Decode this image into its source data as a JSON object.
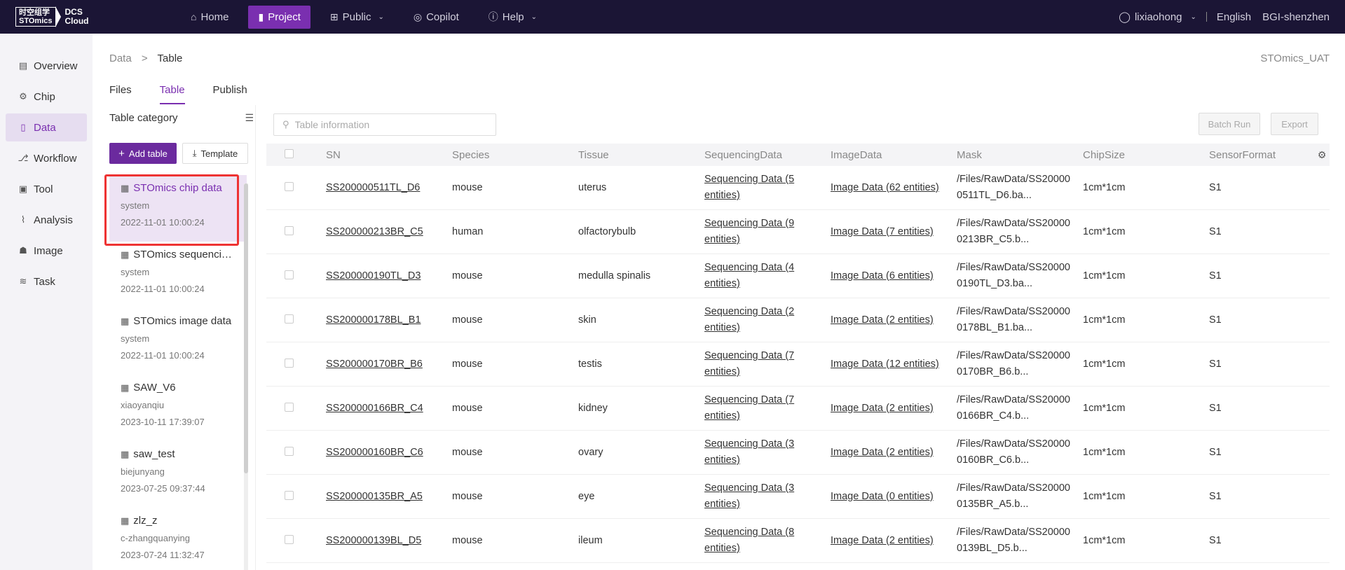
{
  "logo": {
    "cn": "时空组学",
    "en": "STOmics",
    "product_line1": "DCS",
    "product_line2": "Cloud"
  },
  "nav": {
    "items": [
      {
        "label": "Home",
        "icon": "home-icon"
      },
      {
        "label": "Project",
        "icon": "file-icon",
        "active": true
      },
      {
        "label": "Public",
        "icon": "grid-icon",
        "dropdown": true
      },
      {
        "label": "Copilot",
        "icon": "copilot-icon"
      },
      {
        "label": "Help",
        "icon": "help-icon",
        "dropdown": true
      }
    ],
    "user": "lixiaohong",
    "language": "English",
    "region": "BGI-shenzhen"
  },
  "sidebar": {
    "items": [
      {
        "label": "Overview",
        "icon": "document-icon"
      },
      {
        "label": "Chip",
        "icon": "chip-icon"
      },
      {
        "label": "Data",
        "icon": "data-file-icon",
        "active": true
      },
      {
        "label": "Workflow",
        "icon": "workflow-icon"
      },
      {
        "label": "Tool",
        "icon": "tool-icon"
      },
      {
        "label": "Analysis",
        "icon": "analysis-icon"
      },
      {
        "label": "Image",
        "icon": "image-icon"
      },
      {
        "label": "Task",
        "icon": "layers-icon"
      }
    ]
  },
  "breadcrumb": {
    "parent": "Data",
    "separator": ">",
    "current": "Table"
  },
  "tenant": "STOmics_UAT",
  "tabs": [
    {
      "label": "Files"
    },
    {
      "label": "Table",
      "active": true
    },
    {
      "label": "Publish"
    }
  ],
  "category_panel": {
    "title": "Table category",
    "add_button": "Add table",
    "template_button": "Template",
    "items": [
      {
        "name": "STOmics chip data",
        "owner": "system",
        "date": "2022-11-01 10:00:24",
        "active": true
      },
      {
        "name": "STOmics sequencing data",
        "owner": "system",
        "date": "2022-11-01 10:00:24"
      },
      {
        "name": "STOmics image data",
        "owner": "system",
        "date": "2022-11-01 10:00:24"
      },
      {
        "name": "SAW_V6",
        "owner": "xiaoyanqiu",
        "date": "2023-10-11 17:39:07"
      },
      {
        "name": "saw_test",
        "owner": "biejunyang",
        "date": "2023-07-25 09:37:44"
      },
      {
        "name": "zlz_z",
        "owner": "c-zhangquanying",
        "date": "2023-07-24 11:32:47"
      }
    ]
  },
  "toolbar": {
    "search_placeholder": "Table information",
    "batch_run": "Batch Run",
    "export": "Export"
  },
  "table": {
    "columns": [
      "SN",
      "Species",
      "Tissue",
      "SequencingData",
      "ImageData",
      "Mask",
      "ChipSize",
      "SensorFormat"
    ],
    "rows": [
      {
        "sn": "SS200000511TL_D6",
        "species": "mouse",
        "tissue": "uterus",
        "seq": "Sequencing Data (5 entities)",
        "img": "Image Data (62 entities)",
        "mask": "/Files/RawData/SS200000511TL_D6.ba...",
        "chip": "1cm*1cm",
        "sensor": "S1"
      },
      {
        "sn": "SS200000213BR_C5",
        "species": "human",
        "tissue": "olfactorybulb",
        "seq": "Sequencing Data (9 entities)",
        "img": "Image Data (7 entities)",
        "mask": "/Files/RawData/SS200000213BR_C5.b...",
        "chip": "1cm*1cm",
        "sensor": "S1"
      },
      {
        "sn": "SS200000190TL_D3",
        "species": "mouse",
        "tissue": "medulla spinalis",
        "seq": "Sequencing Data (4 entities)",
        "img": "Image Data (6 entities)",
        "mask": "/Files/RawData/SS200000190TL_D3.ba...",
        "chip": "1cm*1cm",
        "sensor": "S1"
      },
      {
        "sn": "SS200000178BL_B1",
        "species": "mouse",
        "tissue": "skin",
        "seq": "Sequencing Data (2 entities)",
        "img": "Image Data (2 entities)",
        "mask": "/Files/RawData/SS200000178BL_B1.ba...",
        "chip": "1cm*1cm",
        "sensor": "S1"
      },
      {
        "sn": "SS200000170BR_B6",
        "species": "mouse",
        "tissue": "testis",
        "seq": "Sequencing Data (7 entities)",
        "img": "Image Data (12 entities)",
        "mask": "/Files/RawData/SS200000170BR_B6.b...",
        "chip": "1cm*1cm",
        "sensor": "S1"
      },
      {
        "sn": "SS200000166BR_C4",
        "species": "mouse",
        "tissue": "kidney",
        "seq": "Sequencing Data (7 entities)",
        "img": "Image Data (2 entities)",
        "mask": "/Files/RawData/SS200000166BR_C4.b...",
        "chip": "1cm*1cm",
        "sensor": "S1"
      },
      {
        "sn": "SS200000160BR_C6",
        "species": "mouse",
        "tissue": "ovary",
        "seq": "Sequencing Data (3 entities)",
        "img": "Image Data (2 entities)",
        "mask": "/Files/RawData/SS200000160BR_C6.b...",
        "chip": "1cm*1cm",
        "sensor": "S1"
      },
      {
        "sn": "SS200000135BR_A5",
        "species": "mouse",
        "tissue": "eye",
        "seq": "Sequencing Data (3 entities)",
        "img": "Image Data (0 entities)",
        "mask": "/Files/RawData/SS200000135BR_A5.b...",
        "chip": "1cm*1cm",
        "sensor": "S1"
      },
      {
        "sn": "SS200000139BL_D5",
        "species": "mouse",
        "tissue": "ileum",
        "seq": "Sequencing Data (8 entities)",
        "img": "Image Data (2 entities)",
        "mask": "/Files/RawData/SS200000139BL_D5.b...",
        "chip": "1cm*1cm",
        "sensor": "S1"
      }
    ]
  },
  "colors": {
    "brand": "#7a2fb0",
    "topbar": "#1b1535",
    "highlight": "#e33333"
  }
}
